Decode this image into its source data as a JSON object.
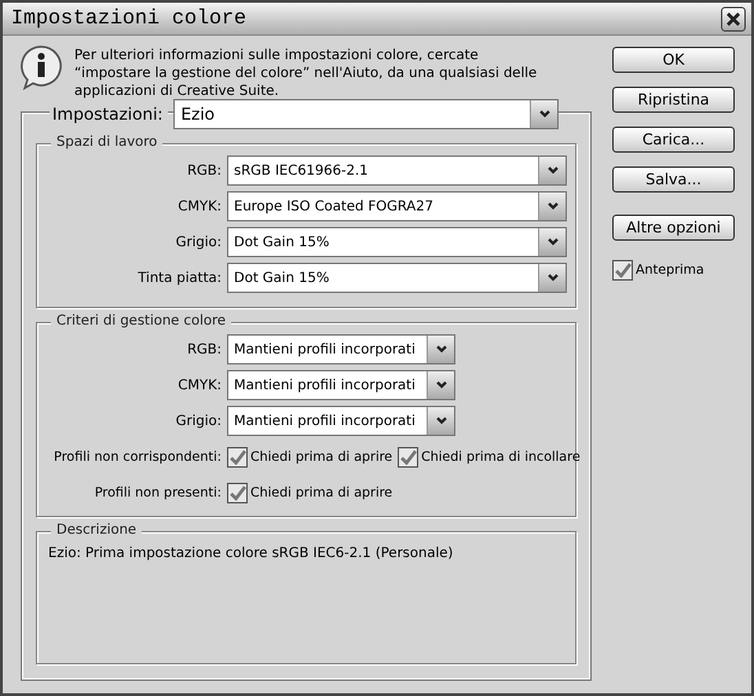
{
  "window": {
    "title": "Impostazioni colore"
  },
  "info": {
    "lines": [
      "Per ulteriori informazioni sulle impostazioni colore, cercate",
      "“impostare la gestione del colore” nell'Aiuto, da una qualsiasi delle",
      "applicazioni di Creative Suite."
    ]
  },
  "settings": {
    "label": "Impostazioni:",
    "value": "Ezio"
  },
  "working_spaces": {
    "title": "Spazi di lavoro",
    "rows": [
      {
        "label": "RGB:",
        "value": "sRGB IEC61966-2.1"
      },
      {
        "label": "CMYK:",
        "value": "Europe ISO Coated FOGRA27"
      },
      {
        "label": "Grigio:",
        "value": "Dot Gain 15%"
      },
      {
        "label": "Tinta piatta:",
        "value": "Dot Gain 15%"
      }
    ]
  },
  "policies": {
    "title": "Criteri di gestione colore",
    "rows": [
      {
        "label": "RGB:",
        "value": "Mantieni profili incorporati"
      },
      {
        "label": "CMYK:",
        "value": "Mantieni profili incorporati"
      },
      {
        "label": "Grigio:",
        "value": "Mantieni profili incorporati"
      }
    ],
    "checks": [
      {
        "label": "Profili non corrispondenti:",
        "options": [
          {
            "label": "Chiedi prima di aprire",
            "checked": true
          },
          {
            "label": "Chiedi prima di incollare",
            "checked": true
          }
        ]
      },
      {
        "label": "Profili non presenti:",
        "options": [
          {
            "label": "Chiedi prima di aprire",
            "checked": true
          }
        ]
      }
    ]
  },
  "description": {
    "title": "Descrizione",
    "text": "Ezio:  Prima impostazione colore sRGB IEC6-2.1  (Personale)"
  },
  "buttons": [
    "OK",
    "Ripristina",
    "Carica...",
    "Salva..."
  ],
  "more_button": {
    "label": "Altre opzioni"
  },
  "preview": {
    "label": "Anteprima",
    "checked": true
  }
}
